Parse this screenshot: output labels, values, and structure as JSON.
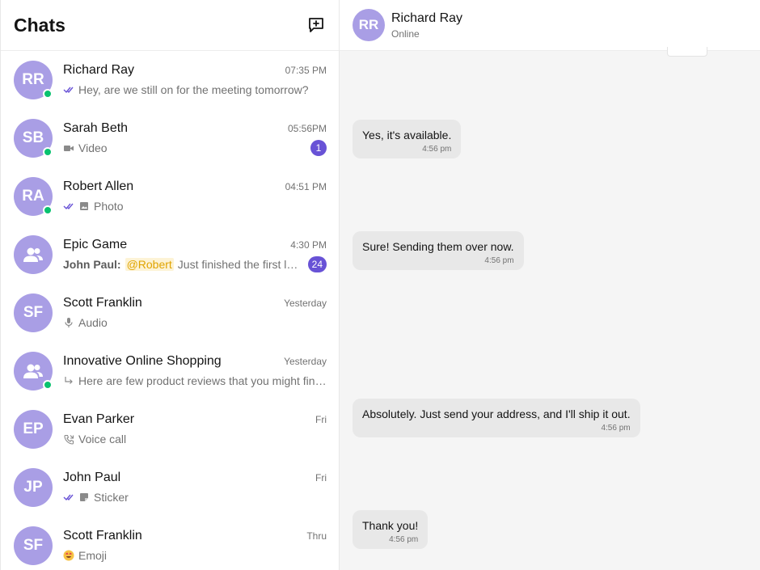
{
  "sidebar": {
    "title": "Chats",
    "chats": [
      {
        "initials": "RR",
        "name": "Richard Ray",
        "time": "07:35 PM",
        "preview": "Hey, are we still on for the meeting tomorrow?",
        "icon": "double-check-icon",
        "online": true
      },
      {
        "initials": "SB",
        "name": "Sarah Beth",
        "time": "05:56PM",
        "preview": "Video",
        "icon": "video-icon",
        "online": true,
        "badge": "1"
      },
      {
        "initials": "RA",
        "name": "Robert Allen",
        "time": "04:51 PM",
        "preview": "Photo",
        "icon": "double-check-image-icon",
        "online": true
      },
      {
        "initials": "",
        "name": "Epic Game",
        "time": "4:30 PM",
        "sender": "John Paul:",
        "mention": "@Robert",
        "preview": "Just finished the first level! Let's go",
        "icon": "group-icon",
        "online": false,
        "badge": "24"
      },
      {
        "initials": "SF",
        "name": "Scott Franklin",
        "time": "Yesterday",
        "preview": "Audio",
        "icon": "mic-icon",
        "online": false
      },
      {
        "initials": "",
        "name": "Innovative Online Shopping",
        "time": "Yesterday",
        "preview": "Here are few product reviews that you might find helpful",
        "icon": "reply-icon",
        "online": true
      },
      {
        "initials": "EP",
        "name": "Evan Parker",
        "time": "Fri",
        "preview": "Voice call",
        "icon": "phone-icon",
        "online": false
      },
      {
        "initials": "JP",
        "name": "John Paul",
        "time": "Fri",
        "preview": "Sticker",
        "icon": "double-check-sticker-icon",
        "online": false
      },
      {
        "initials": "SF",
        "name": "Scott Franklin",
        "time": "Thru",
        "preview": "Emoji",
        "icon": "emoji-icon",
        "online": false
      }
    ]
  },
  "chat": {
    "initials": "RR",
    "name": "Richard Ray",
    "status": "Online",
    "messages": [
      {
        "text": "Yes, it's available.",
        "time": "4:56 pm"
      },
      {
        "text": "Sure! Sending them over now.",
        "time": "4:56 pm"
      },
      {
        "text": "Absolutely. Just send your address, and I'll ship it out.",
        "time": "4:56 pm"
      },
      {
        "text": "Thank you!",
        "time": "4:56 pm"
      }
    ]
  },
  "colors": {
    "accent": "#6852d6",
    "avatar": "#a99ee5",
    "online": "#09c26f",
    "mention_bg": "#fdf3d5",
    "mention_fg": "#e0a400"
  }
}
